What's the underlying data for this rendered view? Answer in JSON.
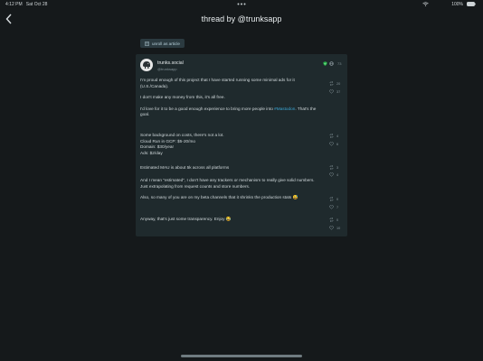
{
  "status": {
    "time": "4:12 PM",
    "date": "Sat Oct 28",
    "battery": "100%"
  },
  "header": {
    "title": "thread by @trunksapp"
  },
  "unroll": {
    "label": "unroll as article"
  },
  "author": {
    "name": "trunks.social",
    "handle": "@trunksapp",
    "count": "73"
  },
  "posts": [
    {
      "paragraphs": [
        "I'm proud enough of this project that I have started running some minimal ads for it (U.S./Canada).",
        "I don't make any money from this, it's all free.",
        "I'd love for it to be a good enough experience to bring more people into #Mastodon. That's the goal."
      ],
      "mention": "#Mastodon",
      "stats": {
        "reposts": "20",
        "likes": "37"
      }
    },
    {
      "lines": [
        "Some background on costs, there's not a lot.",
        "Cloud Run in GCP: $5-20/mo",
        "Domain: $30/year",
        "Ads: $2/day"
      ],
      "stats": {
        "reposts": "4",
        "likes": "6"
      }
    },
    {
      "paragraphs": [
        "Estimated MAU is about 5k across all platforms"
      ],
      "stats": {
        "reposts": "3",
        "likes": "4"
      }
    },
    {
      "paragraphs": [
        "And I mean \"estimated\", I don't have any trackers or mechanism to really give solid numbers. Just extrapolating from request counts and store numbers."
      ],
      "stats": {
        "reposts": "",
        "likes": ""
      }
    },
    {
      "paragraphs": [
        "Also, so many of you are on my beta channels that it shrinks the production stats 😅"
      ],
      "stats": {
        "reposts": "0",
        "likes": "7"
      }
    },
    {
      "paragraphs": [
        "Anyway, that's just some transparency. Enjoy 😂"
      ],
      "stats": {
        "reposts": "0",
        "likes": "10"
      }
    }
  ],
  "icons": {
    "back": "chevron-left-icon",
    "unroll": "document-icon",
    "verified": "shield-check-icon",
    "globe": "globe-icon",
    "repost": "repost-icon",
    "like": "heart-icon",
    "wifi": "wifi-icon",
    "battery": "battery-icon",
    "more": "more-dots-icon"
  },
  "colors": {
    "background": "#15191b",
    "card": "#1f2a2d",
    "accent": "#3aa7d6",
    "verified": "#28b54a"
  }
}
